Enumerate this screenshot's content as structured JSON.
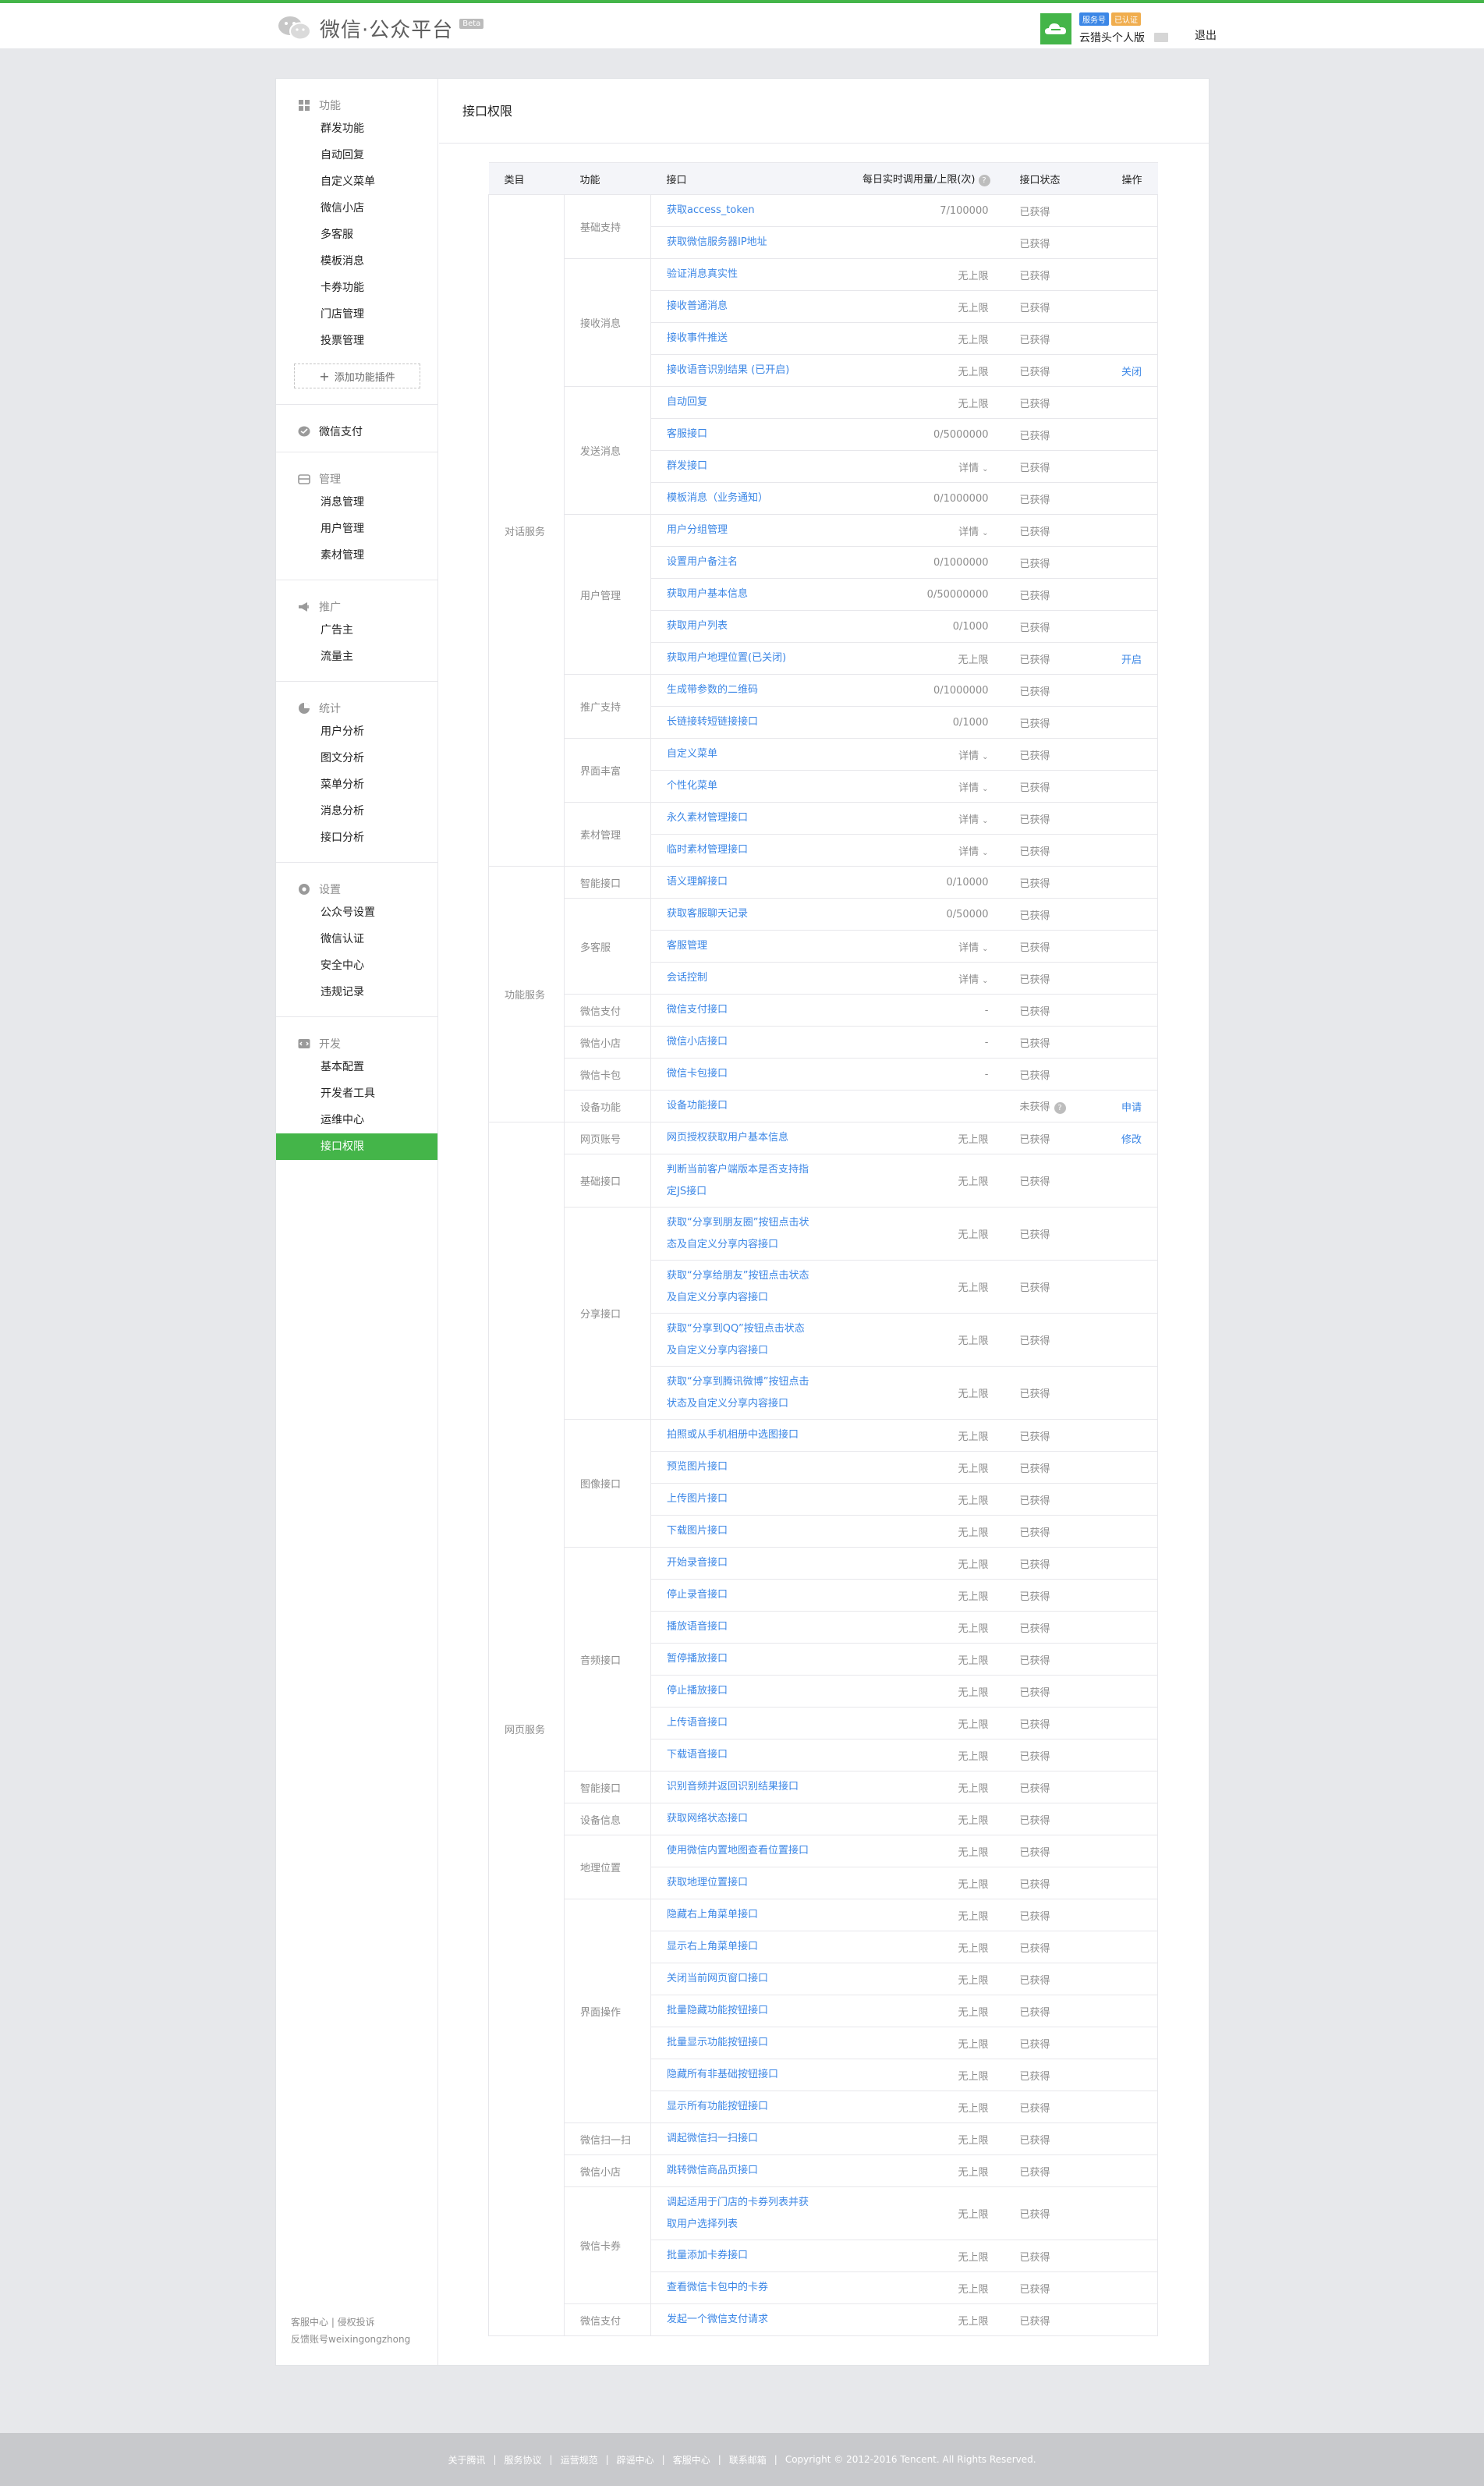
{
  "header": {
    "logo_text": "微信·公众平台",
    "beta": "Beta",
    "badges": [
      "服务号",
      "已认证"
    ],
    "account_name": "云猎头个人版",
    "logout": "退出"
  },
  "sidebar": {
    "groups": [
      {
        "title": "功能",
        "icon": "grid-icon",
        "items": [
          "群发功能",
          "自动回复",
          "自定义菜单",
          "微信小店",
          "多客服",
          "模板消息",
          "卡券功能",
          "门店管理",
          "投票管理"
        ],
        "add": "添加功能插件"
      },
      {
        "title": "微信支付",
        "icon": "pay-icon",
        "items": []
      },
      {
        "title": "管理",
        "icon": "manage-icon",
        "items": [
          "消息管理",
          "用户管理",
          "素材管理"
        ]
      },
      {
        "title": "推广",
        "icon": "promote-icon",
        "items": [
          "广告主",
          "流量主"
        ]
      },
      {
        "title": "统计",
        "icon": "stats-icon",
        "items": [
          "用户分析",
          "图文分析",
          "菜单分析",
          "消息分析",
          "接口分析"
        ]
      },
      {
        "title": "设置",
        "icon": "settings-icon",
        "items": [
          "公众号设置",
          "微信认证",
          "安全中心",
          "违规记录"
        ]
      },
      {
        "title": "开发",
        "icon": "dev-icon",
        "items": [
          "基本配置",
          "开发者工具",
          "运维中心",
          "接口权限"
        ],
        "active": "接口权限"
      }
    ],
    "footer": [
      "客服中心 | 侵权投诉",
      "反馈账号weixingongzhong"
    ]
  },
  "main": {
    "title": "接口权限",
    "headers": {
      "category": "类目",
      "function": "功能",
      "api": "接口",
      "quota": "每日实时调用量/上限(次)",
      "status": "接口状态",
      "op": "操作"
    },
    "groups": [
      {
        "category": "对话服务",
        "functions": [
          {
            "name": "基础支持",
            "apis": [
              {
                "name": "获取access_token",
                "quota": "7/100000",
                "status": "已获得",
                "op": ""
              },
              {
                "name": "获取微信服务器IP地址",
                "quota": "",
                "status": "已获得",
                "op": ""
              }
            ]
          },
          {
            "name": "接收消息",
            "apis": [
              {
                "name": "验证消息真实性",
                "quota": "无上限",
                "status": "已获得",
                "op": ""
              },
              {
                "name": "接收普通消息",
                "quota": "无上限",
                "status": "已获得",
                "op": ""
              },
              {
                "name": "接收事件推送",
                "quota": "无上限",
                "status": "已获得",
                "op": ""
              },
              {
                "name": "接收语音识别结果 (已开启)",
                "quota": "无上限",
                "status": "已获得",
                "op": "关闭"
              }
            ]
          },
          {
            "name": "发送消息",
            "apis": [
              {
                "name": "自动回复",
                "quota": "无上限",
                "status": "已获得",
                "op": ""
              },
              {
                "name": "客服接口",
                "quota": "0/5000000",
                "status": "已获得",
                "op": ""
              },
              {
                "name": "群发接口",
                "quota": "详情",
                "status": "已获得",
                "op": ""
              },
              {
                "name": "模板消息（业务通知）",
                "quota": "0/1000000",
                "status": "已获得",
                "op": ""
              }
            ]
          },
          {
            "name": "用户管理",
            "apis": [
              {
                "name": "用户分组管理",
                "quota": "详情",
                "status": "已获得",
                "op": ""
              },
              {
                "name": "设置用户备注名",
                "quota": "0/1000000",
                "status": "已获得",
                "op": ""
              },
              {
                "name": "获取用户基本信息",
                "quota": "0/50000000",
                "status": "已获得",
                "op": ""
              },
              {
                "name": "获取用户列表",
                "quota": "0/1000",
                "status": "已获得",
                "op": ""
              },
              {
                "name": "获取用户地理位置(已关闭)",
                "quota": "无上限",
                "status": "已获得",
                "op": "开启"
              }
            ]
          },
          {
            "name": "推广支持",
            "apis": [
              {
                "name": "生成带参数的二维码",
                "quota": "0/1000000",
                "status": "已获得",
                "op": ""
              },
              {
                "name": "长链接转短链接接口",
                "quota": "0/1000",
                "status": "已获得",
                "op": ""
              }
            ]
          },
          {
            "name": "界面丰富",
            "apis": [
              {
                "name": "自定义菜单",
                "quota": "详情",
                "status": "已获得",
                "op": ""
              },
              {
                "name": "个性化菜单",
                "quota": "详情",
                "status": "已获得",
                "op": ""
              }
            ]
          },
          {
            "name": "素材管理",
            "apis": [
              {
                "name": "永久素材管理接口",
                "quota": "详情",
                "status": "已获得",
                "op": ""
              },
              {
                "name": "临时素材管理接口",
                "quota": "详情",
                "status": "已获得",
                "op": ""
              }
            ]
          }
        ]
      },
      {
        "category": "功能服务",
        "functions": [
          {
            "name": "智能接口",
            "apis": [
              {
                "name": "语义理解接口",
                "quota": "0/10000",
                "status": "已获得",
                "op": ""
              }
            ]
          },
          {
            "name": "多客服",
            "apis": [
              {
                "name": "获取客服聊天记录",
                "quota": "0/50000",
                "status": "已获得",
                "op": ""
              },
              {
                "name": "客服管理",
                "quota": "详情",
                "status": "已获得",
                "op": ""
              },
              {
                "name": "会话控制",
                "quota": "详情",
                "status": "已获得",
                "op": ""
              }
            ]
          },
          {
            "name": "微信支付",
            "apis": [
              {
                "name": "微信支付接口",
                "quota": "-",
                "status": "已获得",
                "op": ""
              }
            ]
          },
          {
            "name": "微信小店",
            "apis": [
              {
                "name": "微信小店接口",
                "quota": "-",
                "status": "已获得",
                "op": ""
              }
            ]
          },
          {
            "name": "微信卡包",
            "apis": [
              {
                "name": "微信卡包接口",
                "quota": "-",
                "status": "已获得",
                "op": ""
              }
            ]
          },
          {
            "name": "设备功能",
            "apis": [
              {
                "name": "设备功能接口",
                "quota": "",
                "status": "未获得",
                "op": "申请"
              }
            ]
          }
        ]
      },
      {
        "category": "网页服务",
        "functions": [
          {
            "name": "网页账号",
            "apis": [
              {
                "name": "网页授权获取用户基本信息",
                "quota": "无上限",
                "status": "已获得",
                "op": "修改"
              }
            ]
          },
          {
            "name": "基础接口",
            "apis": [
              {
                "name": "判断当前客户端版本是否支持指定JS接口",
                "quota": "无上限",
                "status": "已获得",
                "op": ""
              }
            ]
          },
          {
            "name": "分享接口",
            "apis": [
              {
                "name": "获取“分享到朋友圈”按钮点击状态及自定义分享内容接口",
                "quota": "无上限",
                "status": "已获得",
                "op": ""
              },
              {
                "name": "获取“分享给朋友”按钮点击状态及自定义分享内容接口",
                "quota": "无上限",
                "status": "已获得",
                "op": ""
              },
              {
                "name": "获取“分享到QQ”按钮点击状态及自定义分享内容接口",
                "quota": "无上限",
                "status": "已获得",
                "op": ""
              },
              {
                "name": "获取“分享到腾讯微博”按钮点击状态及自定义分享内容接口",
                "quota": "无上限",
                "status": "已获得",
                "op": ""
              }
            ]
          },
          {
            "name": "图像接口",
            "apis": [
              {
                "name": "拍照或从手机相册中选图接口",
                "quota": "无上限",
                "status": "已获得",
                "op": ""
              },
              {
                "name": "预览图片接口",
                "quota": "无上限",
                "status": "已获得",
                "op": ""
              },
              {
                "name": "上传图片接口",
                "quota": "无上限",
                "status": "已获得",
                "op": ""
              },
              {
                "name": "下载图片接口",
                "quota": "无上限",
                "status": "已获得",
                "op": ""
              }
            ]
          },
          {
            "name": "音频接口",
            "apis": [
              {
                "name": "开始录音接口",
                "quota": "无上限",
                "status": "已获得",
                "op": ""
              },
              {
                "name": "停止录音接口",
                "quota": "无上限",
                "status": "已获得",
                "op": ""
              },
              {
                "name": "播放语音接口",
                "quota": "无上限",
                "status": "已获得",
                "op": ""
              },
              {
                "name": "暂停播放接口",
                "quota": "无上限",
                "status": "已获得",
                "op": ""
              },
              {
                "name": "停止播放接口",
                "quota": "无上限",
                "status": "已获得",
                "op": ""
              },
              {
                "name": "上传语音接口",
                "quota": "无上限",
                "status": "已获得",
                "op": ""
              },
              {
                "name": "下载语音接口",
                "quota": "无上限",
                "status": "已获得",
                "op": ""
              }
            ]
          },
          {
            "name": "智能接口",
            "apis": [
              {
                "name": "识别音频并返回识别结果接口",
                "quota": "无上限",
                "status": "已获得",
                "op": ""
              }
            ]
          },
          {
            "name": "设备信息",
            "apis": [
              {
                "name": "获取网络状态接口",
                "quota": "无上限",
                "status": "已获得",
                "op": ""
              }
            ]
          },
          {
            "name": "地理位置",
            "apis": [
              {
                "name": "使用微信内置地图查看位置接口",
                "quota": "无上限",
                "status": "已获得",
                "op": ""
              },
              {
                "name": "获取地理位置接口",
                "quota": "无上限",
                "status": "已获得",
                "op": ""
              }
            ]
          },
          {
            "name": "界面操作",
            "apis": [
              {
                "name": "隐藏右上角菜单接口",
                "quota": "无上限",
                "status": "已获得",
                "op": ""
              },
              {
                "name": "显示右上角菜单接口",
                "quota": "无上限",
                "status": "已获得",
                "op": ""
              },
              {
                "name": "关闭当前网页窗口接口",
                "quota": "无上限",
                "status": "已获得",
                "op": ""
              },
              {
                "name": "批量隐藏功能按钮接口",
                "quota": "无上限",
                "status": "已获得",
                "op": ""
              },
              {
                "name": "批量显示功能按钮接口",
                "quota": "无上限",
                "status": "已获得",
                "op": ""
              },
              {
                "name": "隐藏所有非基础按钮接口",
                "quota": "无上限",
                "status": "已获得",
                "op": ""
              },
              {
                "name": "显示所有功能按钮接口",
                "quota": "无上限",
                "status": "已获得",
                "op": ""
              }
            ]
          },
          {
            "name": "微信扫一扫",
            "apis": [
              {
                "name": "调起微信扫一扫接口",
                "quota": "无上限",
                "status": "已获得",
                "op": ""
              }
            ]
          },
          {
            "name": "微信小店",
            "apis": [
              {
                "name": "跳转微信商品页接口",
                "quota": "无上限",
                "status": "已获得",
                "op": ""
              }
            ]
          },
          {
            "name": "微信卡券",
            "apis": [
              {
                "name": "调起适用于门店的卡券列表并获取用户选择列表",
                "quota": "无上限",
                "status": "已获得",
                "op": ""
              },
              {
                "name": "批量添加卡券接口",
                "quota": "无上限",
                "status": "已获得",
                "op": ""
              },
              {
                "name": "查看微信卡包中的卡券",
                "quota": "无上限",
                "status": "已获得",
                "op": ""
              }
            ]
          },
          {
            "name": "微信支付",
            "apis": [
              {
                "name": "发起一个微信支付请求",
                "quota": "无上限",
                "status": "已获得",
                "op": ""
              }
            ]
          }
        ]
      }
    ]
  },
  "footer": {
    "links": [
      "关于腾讯",
      "服务协议",
      "运营规范",
      "辟谣中心",
      "客服中心",
      "联系邮箱"
    ],
    "copyright": "Copyright © 2012-2016 Tencent. All Rights Reserved."
  }
}
